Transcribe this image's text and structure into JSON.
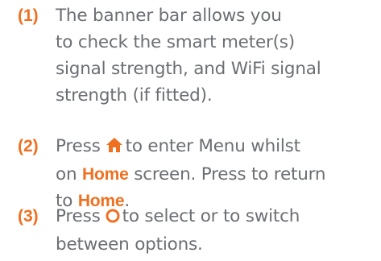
{
  "items": [
    {
      "number": "(1)",
      "lines": [
        "The banner bar allows you",
        "to check the smart meter(s)",
        "signal strength, and WiFi signal",
        "strength (if fitted)."
      ]
    },
    {
      "number": "(2)",
      "line1_before": "Press",
      "line1_after": "to enter Menu whilst",
      "line2_before": "on",
      "line2_highlight": "Home",
      "line2_after": "screen. Press to return",
      "line3_before": "to",
      "line3_highlight": "Home",
      "line3_after": ".",
      "icon": "home-icon"
    },
    {
      "number": "(3)",
      "line1_before": "Press",
      "line1_after": "to select or to switch",
      "line2": "between options.",
      "icon": "select-circle-icon"
    }
  ],
  "colors": {
    "accent": "#ee7020",
    "text": "#6b6e73"
  }
}
